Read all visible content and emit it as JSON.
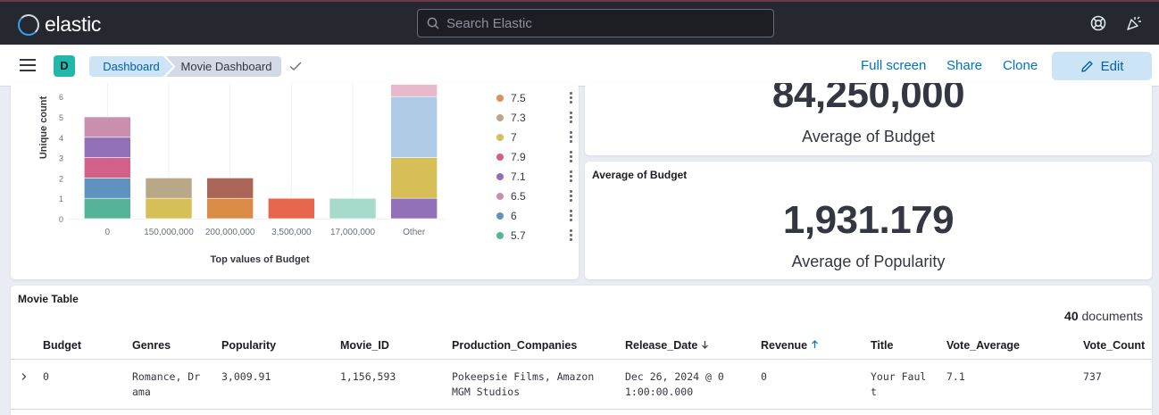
{
  "header": {
    "brand": "elastic",
    "search_placeholder": "Search Elastic",
    "help_icon": "lifebuoy-icon",
    "news_icon": "party-popper-icon"
  },
  "nav": {
    "avatar_letter": "D",
    "breadcrumbs": [
      "Dashboard",
      "Movie Dashboard"
    ],
    "links": [
      "Full screen",
      "Share",
      "Clone"
    ],
    "edit_label": "Edit"
  },
  "bar_panel": {
    "legend": [
      {
        "label": "7.5",
        "color": "#d6915e"
      },
      {
        "label": "7.3",
        "color": "#b9a888"
      },
      {
        "label": "7",
        "color": "#d6bf57"
      },
      {
        "label": "7.9",
        "color": "#d36086"
      },
      {
        "label": "7.1",
        "color": "#9170b8"
      },
      {
        "label": "6.5",
        "color": "#ca8eae"
      },
      {
        "label": "6",
        "color": "#6092c0"
      },
      {
        "label": "5.7",
        "color": "#54b399"
      }
    ]
  },
  "chart_data": {
    "type": "bar",
    "stacked": true,
    "xlabel": "Top values of Budget",
    "ylabel": "Unique count",
    "categories": [
      "0",
      "150,000,000",
      "200,000,000",
      "3,500,000",
      "17,000,000",
      "Other"
    ],
    "yticks": [
      0,
      1,
      2,
      3,
      4,
      5,
      6
    ],
    "segments": [
      {
        "category": "0",
        "from": 0,
        "to": 1,
        "color": "#54b399"
      },
      {
        "category": "0",
        "from": 1,
        "to": 2,
        "color": "#6092c0"
      },
      {
        "category": "0",
        "from": 2,
        "to": 3,
        "color": "#d36086"
      },
      {
        "category": "0",
        "from": 3,
        "to": 4,
        "color": "#9170b8"
      },
      {
        "category": "0",
        "from": 4,
        "to": 5,
        "color": "#ca8eae"
      },
      {
        "category": "150,000,000",
        "from": 0,
        "to": 1,
        "color": "#d6bf57"
      },
      {
        "category": "150,000,000",
        "from": 1,
        "to": 2,
        "color": "#b9a888"
      },
      {
        "category": "200,000,000",
        "from": 0,
        "to": 1,
        "color": "#da8b45"
      },
      {
        "category": "200,000,000",
        "from": 1,
        "to": 2,
        "color": "#aa6556"
      },
      {
        "category": "3,500,000",
        "from": 0,
        "to": 1,
        "color": "#e7664c"
      },
      {
        "category": "17,000,000",
        "from": 0,
        "to": 1,
        "color": "#a6dbcc"
      },
      {
        "category": "Other",
        "from": 0,
        "to": 1,
        "color": "#9170b8"
      },
      {
        "category": "Other",
        "from": 1,
        "to": 3,
        "color": "#d6bf57"
      },
      {
        "category": "Other",
        "from": 3,
        "to": 6,
        "color": "#aecce6"
      },
      {
        "category": "Other",
        "from": 6,
        "to": 6.6,
        "color": "#e8b8cc"
      }
    ]
  },
  "metric_top": {
    "value": "84,250,000",
    "label": "Average of Budget"
  },
  "metric_popularity": {
    "title": "Average of Budget",
    "value": "1,931.179",
    "label": "Average of Popularity"
  },
  "table": {
    "title": "Movie Table",
    "doc_count": "40",
    "doc_suffix": "documents",
    "columns": [
      "Budget",
      "Genres",
      "Popularity",
      "Movie_ID",
      "Production_Companies",
      "Release_Date",
      "Revenue",
      "Title",
      "Vote_Average",
      "Vote_Count"
    ],
    "rows": [
      {
        "budget": "0",
        "genres": "Romance, Dr ama",
        "popularity": "3,009.91",
        "movie_id": "1,156,593",
        "companies": "Pokeepsie Films, Amazon MGM Studios",
        "release": "Dec 26, 2024 @ 0 1:00:00.000",
        "revenue": "0",
        "title": "Your Faul t",
        "vote_avg": "7.1",
        "vote_count": "737"
      }
    ]
  }
}
